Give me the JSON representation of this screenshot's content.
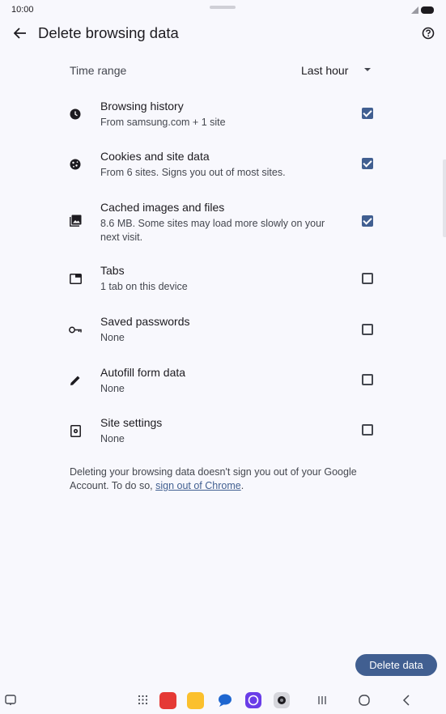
{
  "status": {
    "time": "10:00"
  },
  "appbar": {
    "title": "Delete browsing data"
  },
  "time_range": {
    "label": "Time range",
    "value": "Last hour"
  },
  "items": [
    {
      "title": "Browsing history",
      "subtitle": "From samsung.com + 1 site",
      "checked": true,
      "icon": "clock-icon"
    },
    {
      "title": "Cookies and site data",
      "subtitle": "From 6 sites. Signs you out of most sites.",
      "checked": true,
      "icon": "cookie-icon"
    },
    {
      "title": "Cached images and files",
      "subtitle": "8.6 MB. Some sites may load more slowly on your next visit.",
      "checked": true,
      "icon": "image-icon"
    },
    {
      "title": "Tabs",
      "subtitle": "1 tab on this device",
      "checked": false,
      "icon": "tab-icon"
    },
    {
      "title": "Saved passwords",
      "subtitle": "None",
      "checked": false,
      "icon": "key-icon"
    },
    {
      "title": "Autofill form data",
      "subtitle": "None",
      "checked": false,
      "icon": "pencil-icon"
    },
    {
      "title": "Site settings",
      "subtitle": "None",
      "checked": false,
      "icon": "site-settings-icon"
    }
  ],
  "footer": {
    "text_before": "Deleting your browsing data doesn't sign you out of your Google Account. To do so, ",
    "link": "sign out of Chrome",
    "text_after": "."
  },
  "actions": {
    "delete_label": "Delete data"
  },
  "colors": {
    "accent": "#415f91",
    "background": "#f8f8fd"
  }
}
